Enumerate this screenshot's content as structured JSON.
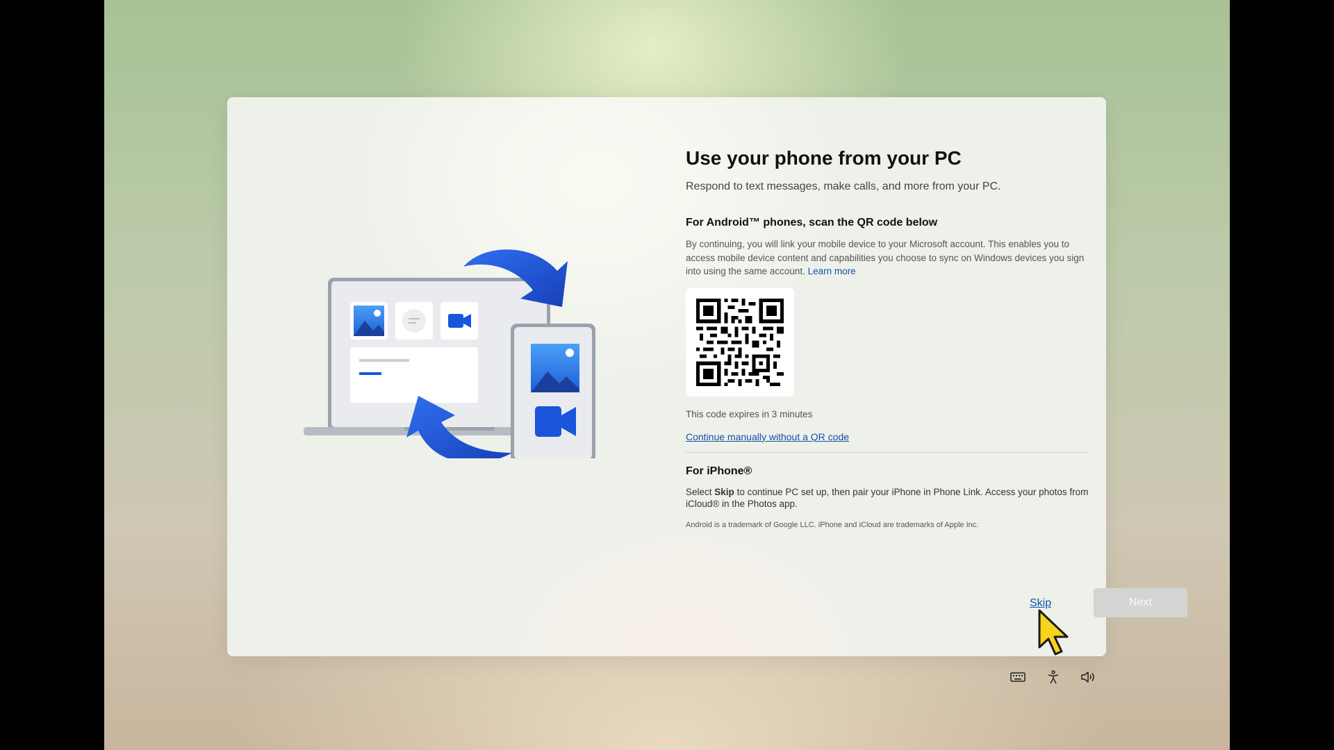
{
  "title": "Use your phone from your PC",
  "subtitle": "Respond to text messages, make calls, and more from your PC.",
  "android": {
    "heading": "For Android™ phones, scan the QR code below",
    "description": "By continuing, you will link your mobile device to your Microsoft account. This enables you to access mobile device content and capabilities you choose to sync on Windows devices you sign into using the same account.",
    "learn_more": "Learn more",
    "qr_icon": "qr-code",
    "expiry": "This code expires in 3 minutes",
    "manual_link": "Continue manually without a QR code"
  },
  "iphone": {
    "heading": "For iPhone®",
    "desc_prefix": "Select",
    "desc_bold": "Skip",
    "desc_suffix": "to continue PC set up, then pair your iPhone in Phone Link. Access your photos from iCloud® in the Photos app.",
    "trademark": "Android is a trademark of Google LLC. iPhone and iCloud are trademarks of Apple Inc."
  },
  "buttons": {
    "skip": "Skip",
    "next": "Next",
    "next_enabled": false
  },
  "system_tray": [
    {
      "icon": "keyboard-icon"
    },
    {
      "icon": "accessibility-icon"
    },
    {
      "icon": "volume-icon"
    }
  ],
  "colors": {
    "accent": "#1052a8",
    "illustration_blue": "#1a56db",
    "cursor_yellow": "#f7d31c"
  }
}
